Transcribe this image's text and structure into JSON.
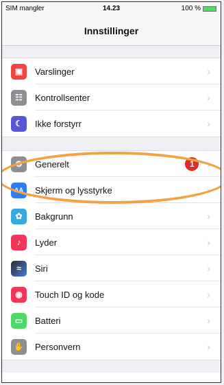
{
  "status": {
    "carrier": "SIM mangler",
    "time": "14.23",
    "battery": "100 %"
  },
  "nav": {
    "title": "Innstillinger"
  },
  "group1": [
    {
      "label": "Varslinger",
      "icon": "notifications-icon",
      "color": "#f2453d"
    },
    {
      "label": "Kontrollsenter",
      "icon": "control-center-icon",
      "color": "#8e8e93"
    },
    {
      "label": "Ikke forstyrr",
      "icon": "moon-icon",
      "color": "#5856d6"
    }
  ],
  "group2": [
    {
      "label": "Generelt",
      "icon": "gear-icon",
      "color": "#8e8e93",
      "badge": "1"
    },
    {
      "label": "Skjerm og lysstyrke",
      "icon": "display-icon",
      "color": "#2f7cf6"
    },
    {
      "label": "Bakgrunn",
      "icon": "wallpaper-icon",
      "color": "#35aadc"
    },
    {
      "label": "Lyder",
      "icon": "sound-icon",
      "color": "#f2365a"
    },
    {
      "label": "Siri",
      "icon": "siri-icon",
      "color": "#2b2b2b"
    },
    {
      "label": "Touch ID og kode",
      "icon": "fingerprint-icon",
      "color": "#f2365a"
    },
    {
      "label": "Batteri",
      "icon": "battery-icon",
      "color": "#4cd964"
    },
    {
      "label": "Personvern",
      "icon": "hand-icon",
      "color": "#8e8e93"
    }
  ]
}
